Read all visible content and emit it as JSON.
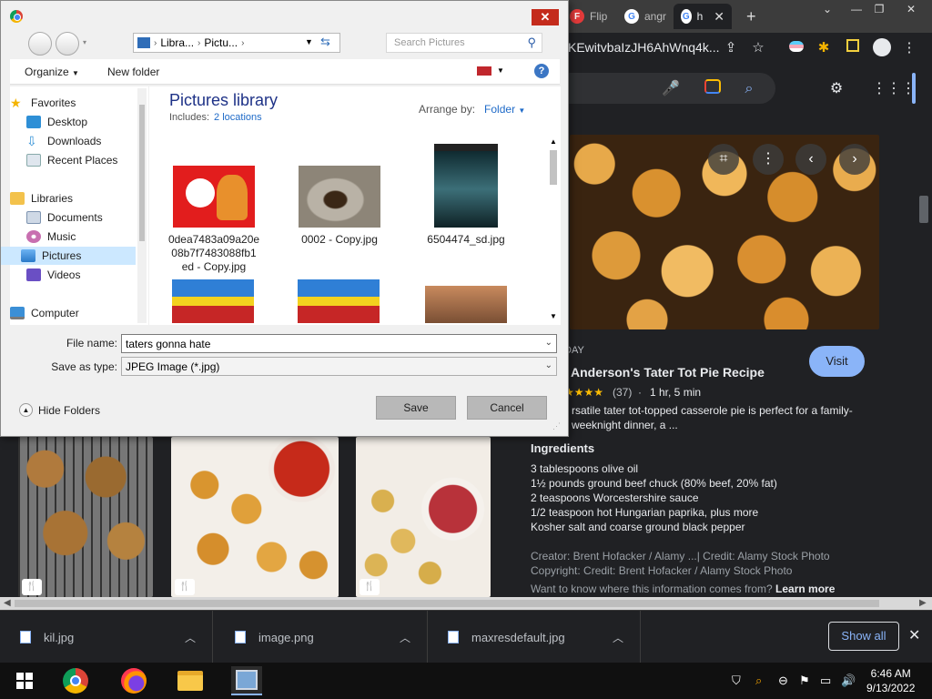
{
  "browser": {
    "tabs": [
      {
        "title": "Flip",
        "favicon": "flip-icon"
      },
      {
        "title": "angr",
        "favicon": "google-icon"
      },
      {
        "title": "h",
        "favicon": "google-icon",
        "active": true
      }
    ],
    "new_tab_label": "+",
    "url": "KEwitvbaIzJH6AhWnq4k...",
    "colors": {
      "background": "#202124",
      "tabstrip": "#3c3c3c",
      "accent": "#8ab4f8"
    }
  },
  "preview": {
    "source_fragment": "DAY",
    "title": "Anderson's Tater Tot Pie Recipe",
    "rating_count": "(37)",
    "rating_sep": "·",
    "duration": "1 hr, 5 min",
    "description_line1": "rsatile tater tot-topped casserole pie is perfect for a family-",
    "description_line2": "weeknight dinner, a ...",
    "visit_label": "Visit",
    "ingredients_heading": "Ingredients",
    "ingredients": [
      "3 tablespoons olive oil",
      "1½ pounds ground beef chuck (80% beef, 20% fat)",
      "2 teaspoons Worcestershire sauce",
      "1/2 teaspoon hot Hungarian paprika, plus more",
      "Kosher salt and coarse ground black pepper"
    ],
    "creator": "Creator: Brent Hofacker / Alamy ...| Credit: Alamy Stock Photo",
    "copyright": "Copyright: Credit: Brent Hofacker / Alamy Stock Photo",
    "info_question": "Want to know where this information comes from?",
    "learn_more": "Learn more"
  },
  "downloads": {
    "items": [
      "kil.jpg",
      "image.png",
      "maxresdefault.jpg"
    ],
    "show_all_label": "Show all"
  },
  "taskbar": {
    "time": "6:46 AM",
    "date": "9/13/2022"
  },
  "dialog": {
    "breadcrumb": [
      "Libra...",
      "Pictu..."
    ],
    "search_placeholder": "Search Pictures",
    "organize_label": "Organize",
    "new_folder_label": "New folder",
    "nav": {
      "favorites": "Favorites",
      "desktop": "Desktop",
      "downloads": "Downloads",
      "recent": "Recent Places",
      "libraries": "Libraries",
      "documents": "Documents",
      "music": "Music",
      "pictures": "Pictures",
      "videos": "Videos",
      "computer": "Computer"
    },
    "library_title": "Pictures library",
    "includes_label": "Includes:",
    "includes_link": "2 locations",
    "arrange_label": "Arrange by:",
    "arrange_value": "Folder",
    "files": [
      {
        "name": "0dea7483a09a20e08b7f7483088fb1ed - Copy.jpg",
        "line1": "0dea7483a09a20e",
        "line2": "08b7f7483088fb1",
        "line3": "ed - Copy.jpg"
      },
      {
        "name": "0002 - Copy.jpg",
        "line1": "0002 - Copy.jpg"
      },
      {
        "name": "6504474_sd.jpg",
        "line1": "6504474_sd.jpg"
      }
    ],
    "file_name_label": "File name:",
    "file_name_value": "taters gonna hate",
    "save_type_label": "Save as type:",
    "save_type_value": "JPEG Image (*.jpg)",
    "save_label": "Save",
    "cancel_label": "Cancel",
    "hide_folders_label": "Hide Folders"
  }
}
